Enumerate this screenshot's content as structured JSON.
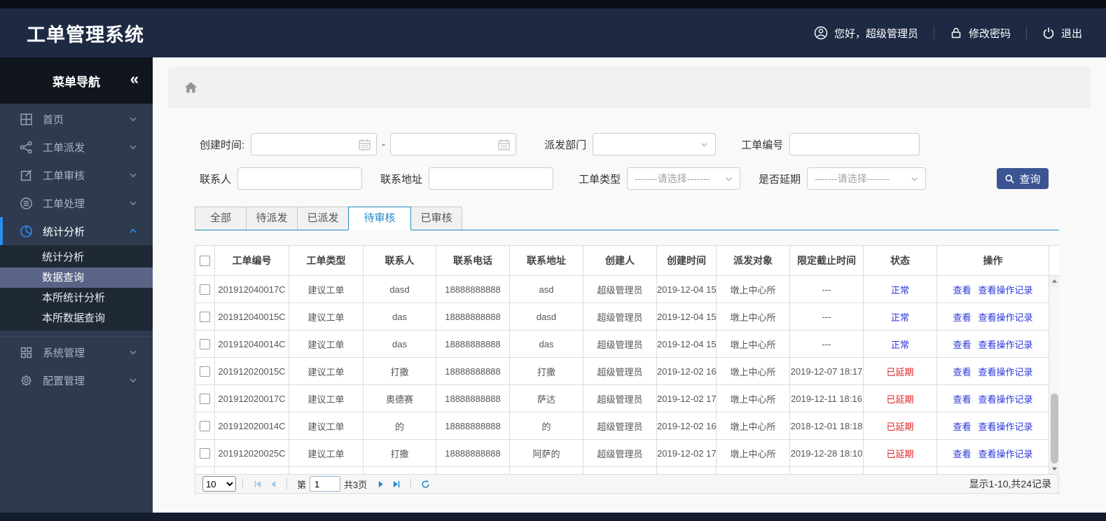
{
  "app": {
    "title": "工单管理系统"
  },
  "header": {
    "greeting": "您好，超级管理员",
    "change_password": "修改密码",
    "logout": "退出"
  },
  "sidebar": {
    "title": "菜单导航",
    "collapse_glyph": "«",
    "items": [
      "首页",
      "工单派发",
      "工单审核",
      "工单处理",
      "统计分析",
      "系统管理",
      "配置管理"
    ],
    "submenu": [
      {
        "label": "统计分析"
      },
      {
        "label": "数据查询",
        "selected": true
      },
      {
        "label": "本所统计分析"
      },
      {
        "label": "本所数据查询"
      }
    ]
  },
  "filters": {
    "created_label": "创建时间:",
    "range_separator": "-",
    "department_label": "派发部门",
    "order_no_label": "工单编号",
    "contact_label": "联系人",
    "address_label": "联系地址",
    "type_label": "工单类型",
    "delay_label": "是否延期",
    "select_placeholder": "-------请选择-------",
    "search_button": "查询"
  },
  "tabs": [
    {
      "label": "全部"
    },
    {
      "label": "待派发"
    },
    {
      "label": "已派发"
    },
    {
      "label": "待审核",
      "active": true
    },
    {
      "label": "已审核"
    }
  ],
  "table": {
    "columns": [
      "工单编号",
      "工单类型",
      "联系人",
      "联系电话",
      "联系地址",
      "创建人",
      "创建时间",
      "派发对象",
      "限定截止时间",
      "状态",
      "操作"
    ],
    "row_actions": [
      "查看",
      "查看操作记录"
    ],
    "status_colors": {
      "normal": "#2936d8",
      "delayed": "#e02222"
    },
    "rows": [
      {
        "id": "201912040017C",
        "type": "建议工单",
        "contact": "dasd",
        "phone": "18888888888",
        "address": "asd",
        "creator": "超级管理员",
        "created": "2019-12-04 15",
        "target": "墩上中心所",
        "deadline": "---",
        "status": "正常",
        "status_color": "#2936d8"
      },
      {
        "id": "201912040015C",
        "type": "建议工单",
        "contact": "das",
        "phone": "18888888888",
        "address": "dasd",
        "creator": "超级管理员",
        "created": "2019-12-04 15",
        "target": "墩上中心所",
        "deadline": "---",
        "status": "正常",
        "status_color": "#2936d8"
      },
      {
        "id": "201912040014C",
        "type": "建议工单",
        "contact": "das",
        "phone": "18888888888",
        "address": "das",
        "creator": "超级管理员",
        "created": "2019-12-04 15",
        "target": "墩上中心所",
        "deadline": "---",
        "status": "正常",
        "status_color": "#2936d8"
      },
      {
        "id": "201912020015C",
        "type": "建议工单",
        "contact": "打撒",
        "phone": "18888888888",
        "address": "打撒",
        "creator": "超级管理员",
        "created": "2019-12-02 16",
        "target": "墩上中心所",
        "deadline": "2019-12-07 18:17",
        "status": "已延期",
        "status_color": "#e02222"
      },
      {
        "id": "201912020017C",
        "type": "建议工单",
        "contact": "奥德赛",
        "phone": "18888888888",
        "address": "萨达",
        "creator": "超级管理员",
        "created": "2019-12-02 17",
        "target": "墩上中心所",
        "deadline": "2019-12-11 18:16",
        "status": "已延期",
        "status_color": "#e02222"
      },
      {
        "id": "201912020014C",
        "type": "建议工单",
        "contact": "的",
        "phone": "18888888888",
        "address": "的",
        "creator": "超级管理员",
        "created": "2019-12-02 16",
        "target": "墩上中心所",
        "deadline": "2018-12-01 18:18",
        "status": "已延期",
        "status_color": "#e02222"
      },
      {
        "id": "201912020025C",
        "type": "建议工单",
        "contact": "打撒",
        "phone": "18888888888",
        "address": "阿萨的",
        "creator": "超级管理员",
        "created": "2019-12-02 17",
        "target": "墩上中心所",
        "deadline": "2019-12-28 18:10",
        "status": "已延期",
        "status_color": "#e02222"
      }
    ]
  },
  "pagination": {
    "page_size": "10",
    "page_label": "第",
    "page_value": "1",
    "total_pages": "共3页",
    "info": "显示1-10,共24记录"
  }
}
